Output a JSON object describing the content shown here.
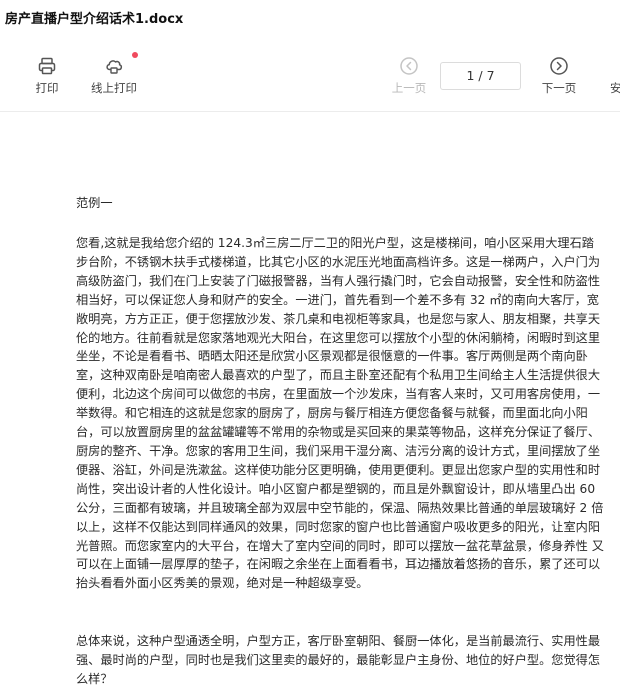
{
  "window": {
    "title": "房产直播户型介绍话术1.docx"
  },
  "toolbar": {
    "print_label": "打印",
    "online_print_label": "线上打印",
    "prev_label": "上一页",
    "next_label": "下一页",
    "partial_label": "安",
    "page_indicator": "1  /  7",
    "icons": {
      "print": "printer-icon",
      "online_print": "cloud-printer-icon",
      "prev": "arrow-left-circle-icon",
      "next": "arrow-right-circle-icon"
    },
    "badge_color": "#f04a5e"
  },
  "document": {
    "heading": "范例一",
    "paragraph1": "您看,这就是我给您介绍的 124.3㎡三房二厅二卫的阳光户型，这是楼梯间，咱小区采用大理石踏步台阶，不锈钢木扶手式楼梯道，比其它小区的水泥压光地面高档许多。这是一梯两户，入户门为高级防盗门，我们在门上安装了门磁报警器，当有人强行撬门时，它会自动报警，安全性和防盗性相当好，可以保证您人身和财产的安全。一进门，首先看到一个差不多有 32 ㎡的南向大客厅，宽敞明亮，方方正正，便于您摆放沙发、茶几桌和电视柜等家具，也是您与家人、朋友相聚，共享天伦的地方。往前看就是您家落地观光大阳台，在这里您可以摆放个小型的休闲躺椅，闲暇时到这里坐坐，不论是看看书、晒晒太阳还是欣赏小区景观都是很惬意的一件事。客厅两侧是两个南向卧室，这种双南卧是咱南密人最喜欢的户型了，而且主卧室还配有个私用卫生间给主人生活提供很大便利，北边这个房间可以做您的书房，在里面放一个沙发床，当有客人来时，又可用客房使用，一举数得。和它相连的这就是您家的厨房了，厨房与餐厅相连方便您备餐与就餐，而里面北向小阳台，可以放置厨房里的盆盆罐罐等不常用的杂物或是买回来的果菜等物品，这样充分保证了餐厅、厨房的整齐、干净。您家的客用卫生间，我们采用干湿分离、洁污分离的设计方式，里间摆放了坐便器、浴缸，外间是洗漱盆。这样使功能分区更明确，使用更便利。更显出您家户型的实用性和时尚性，突出设计者的人性化设计。咱小区窗户都是塑钢的，而且是外飘窗设计，即从墙里凸出 60 公分，三面都有玻璃，并且玻璃全部为双层中空节能的，保温、隔热效果比普通的单层玻璃好 2 倍以上，这样不仅能达到同样通风的效果，同时您家的窗户也比普通窗户吸收更多的阳光，让室内阳光普照。而您家室内的大平台，在增大了室内空间的同时，即可以摆放一盆花草盆景，修身养性 又可以在上面铺一层厚厚的垫子，在闲暇之余坐在上面看看书，耳边播放着悠扬的音乐，累了还可以抬头看看外面小区秀美的景观，绝对是一种超级享受。",
    "paragraph2": "总体来说，这种户型通透全明，户型方正，客厅卧室朝阳、餐厨一体化，是当前最流行、实用性最强、最时尚的户型，同时也是我们这里卖的最好的，最能彰显户主身份、地位的好户型。您觉得怎么样？"
  }
}
